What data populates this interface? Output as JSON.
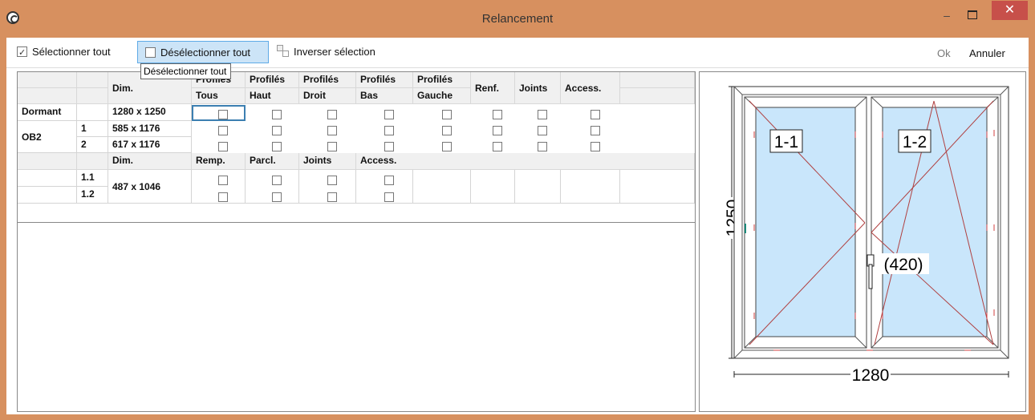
{
  "window": {
    "title": "Relancement",
    "minimize": "–",
    "maximize": "",
    "close": "✕"
  },
  "toolbar": {
    "select_all": "Sélectionner tout",
    "deselect_all": "Désélectionner tout",
    "invert": "Inverser sélection",
    "ok": "Ok",
    "cancel": "Annuler",
    "tooltip": "Désélectionner tout"
  },
  "grid": {
    "header1": [
      "Dim.",
      "Profilés",
      "Profilés",
      "Profilés",
      "Profilés",
      "Profilés",
      "Renf.",
      "Joints",
      "Access."
    ],
    "header2": [
      "Tous",
      "Haut",
      "Droit",
      "Bas",
      "Gauche"
    ],
    "rows": [
      {
        "label": "Dormant",
        "sub": "",
        "dim": "1280 x 1250"
      },
      {
        "label": "OB2",
        "sub": "1",
        "dim": "585 x 1176"
      },
      {
        "label": "",
        "sub": "2",
        "dim": "617 x 1176"
      }
    ],
    "sub_header": [
      "Dim.",
      "Remp.",
      "Parcl.",
      "Joints",
      "Access."
    ],
    "sub_rows": [
      {
        "sub": "1.1",
        "dim": "487 x 1046"
      },
      {
        "sub": "1.2",
        "dim": ""
      }
    ]
  },
  "drawing": {
    "width_label": "1280",
    "height_label": "1250",
    "sash1_label": "1-1",
    "sash2_label": "1-2",
    "handle_label": "(420)"
  },
  "colors": {
    "titlebar": "#d7905f",
    "glass": "#c9e6fb",
    "close": "#c7504a"
  }
}
